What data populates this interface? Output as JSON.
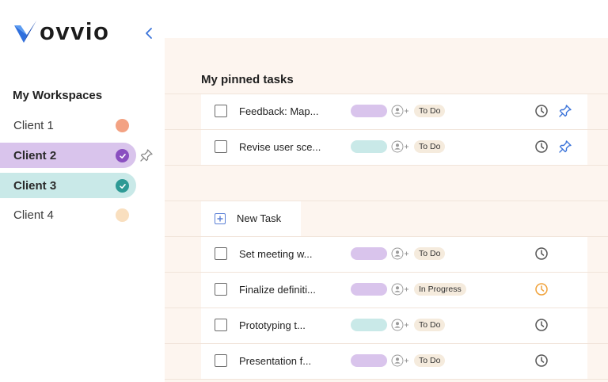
{
  "app": {
    "brand": "ovvio"
  },
  "sidebar": {
    "workspaces_title": "My Workspaces",
    "clients": [
      {
        "label": "Client 1",
        "color": "#f3a283",
        "selected": false
      },
      {
        "label": "Client 2",
        "color": "#8a4fc0",
        "selected": true
      },
      {
        "label": "Client 3",
        "color": "#2e9a95",
        "selected": true
      },
      {
        "label": "Client 4",
        "color": "#f9dfbf",
        "selected": false
      }
    ]
  },
  "pinned": {
    "title": "My pinned tasks",
    "tasks": [
      {
        "title": "Feedback: Map...",
        "tag_color": "#d9c4ec",
        "status": "To Do",
        "pinned": true
      },
      {
        "title": "Revise user sce...",
        "tag_color": "#c9e9e8",
        "status": "To Do",
        "pinned": true
      }
    ]
  },
  "tasks": {
    "new_task_label": "New Task",
    "items": [
      {
        "title": "Set meeting w...",
        "tag_color": "#d9c4ec",
        "status": "To Do",
        "clock_color": "#555555"
      },
      {
        "title": "Finalize definiti...",
        "tag_color": "#d9c4ec",
        "status": "In Progress",
        "clock_color": "#f0a23b"
      },
      {
        "title": "Prototyping t...",
        "tag_color": "#c9e9e8",
        "status": "To Do",
        "clock_color": "#555555"
      },
      {
        "title": "Presentation f...",
        "tag_color": "#d9c4ec",
        "status": "To Do",
        "clock_color": "#555555"
      }
    ]
  },
  "colors": {
    "accent_blue": "#3a73d9",
    "main_background": "#fdf5ef"
  }
}
